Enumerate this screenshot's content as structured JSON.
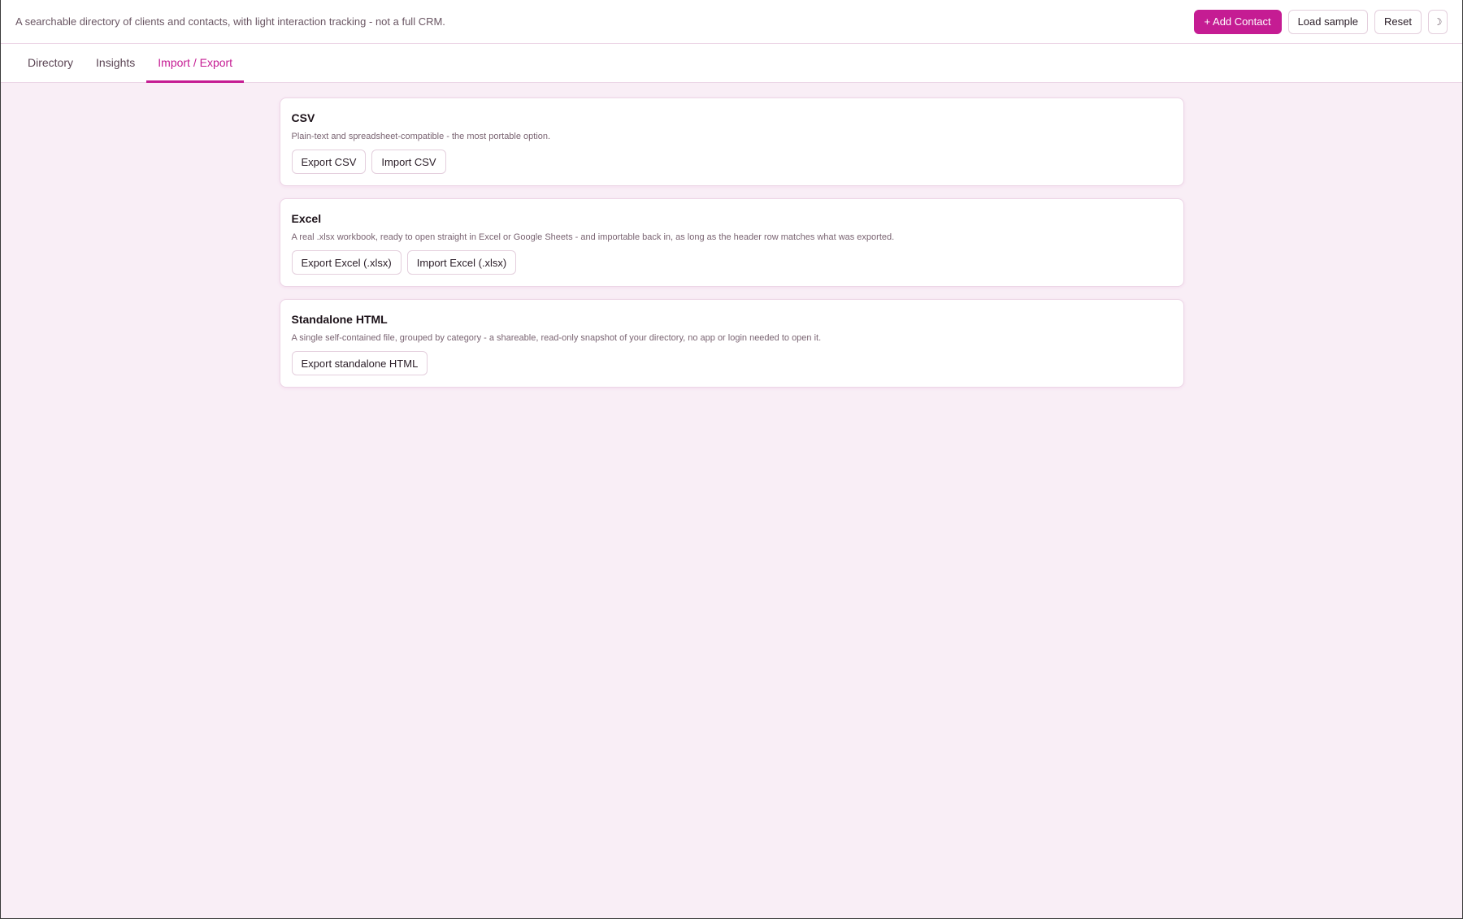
{
  "header": {
    "tagline": "A searchable directory of clients and contacts, with light interaction tracking - not a full CRM.",
    "add_contact_label": "+ Add Contact",
    "load_sample_label": "Load sample",
    "reset_label": "Reset",
    "theme_toggle_icon": "moon-icon",
    "theme_toggle_glyph": "☽"
  },
  "tabs": [
    {
      "label": "Directory",
      "active": false
    },
    {
      "label": "Insights",
      "active": false
    },
    {
      "label": "Import / Export",
      "active": true
    }
  ],
  "sections": [
    {
      "title": "CSV",
      "description": "Plain-text and spreadsheet-compatible - the most portable option.",
      "buttons": [
        "Export CSV",
        "Import CSV"
      ]
    },
    {
      "title": "Excel",
      "description": "A real .xlsx workbook, ready to open straight in Excel or Google Sheets - and importable back in, as long as the header row matches what was exported.",
      "buttons": [
        "Export Excel (.xlsx)",
        "Import Excel (.xlsx)"
      ]
    },
    {
      "title": "Standalone HTML",
      "description": "A single self-contained file, grouped by category - a shareable, read-only snapshot of your directory, no app or login needed to open it.",
      "buttons": [
        "Export standalone HTML"
      ]
    }
  ],
  "colors": {
    "accent": "#c51c93",
    "background": "#f9eef6",
    "card_border": "#ecd6e6"
  }
}
